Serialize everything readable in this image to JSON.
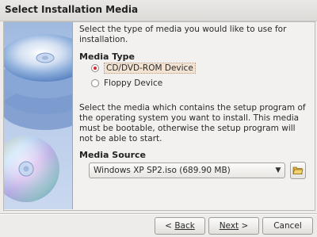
{
  "window": {
    "title": "Select Installation Media"
  },
  "intro_text": "Select the type of media you would like to use for installation.",
  "media_type": {
    "heading": "Media Type",
    "options": [
      {
        "label": "CD/DVD-ROM Device",
        "selected": true
      },
      {
        "label": "Floppy Device",
        "selected": false
      }
    ]
  },
  "description": "Select the media which contains the setup program of the operating system you want to install. This media must be bootable, otherwise the setup program will not be able to start.",
  "media_source": {
    "heading": "Media Source",
    "selected_value": "Windows XP SP2.iso (689.90 MB)",
    "browse_icon": "folder-open-icon"
  },
  "buttons": {
    "back": "Back",
    "next": "Next",
    "cancel": "Cancel"
  },
  "colors": {
    "radio_selected": "#d5252e",
    "side_panel": "#b7cbe9"
  }
}
